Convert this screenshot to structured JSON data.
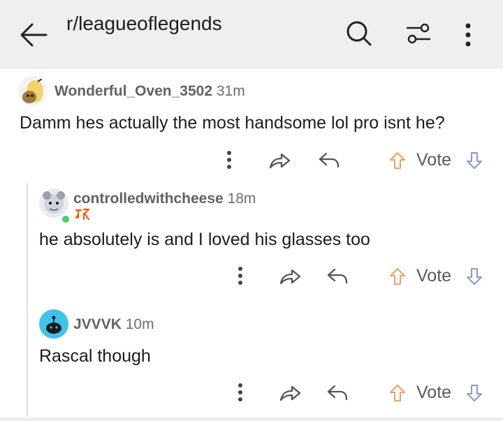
{
  "header": {
    "title": "r/leagueoflegends",
    "back_icon": "arrow-left-icon",
    "search_icon": "search-icon",
    "filter_icon": "sort-filter-icon",
    "more_icon": "more-vertical-icon"
  },
  "comments": [
    {
      "username": "Wonderful_Oven_3502",
      "time": "31m",
      "body": "Damm hes actually the most handsome lol pro isnt he?",
      "vote_label": "Vote"
    },
    {
      "username": "controlledwithcheese",
      "time": "18m",
      "flair_icon": "fnatic-flair-icon",
      "online_color": "#46d160",
      "body": "he absolutely is and I loved his glasses too",
      "vote_label": "Vote"
    },
    {
      "username": "JVVVK",
      "time": "10m",
      "body": "Rascal though",
      "vote_label": "Vote"
    }
  ],
  "colors": {
    "header_bg": "#eeeff1",
    "upvote": "#f0a060",
    "downvote": "#8899cc",
    "flair": "#ff5900",
    "avatar_blue": "#3fc3e8"
  }
}
